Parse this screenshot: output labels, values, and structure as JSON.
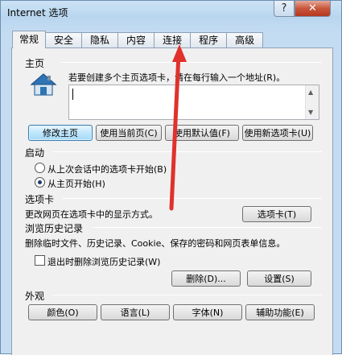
{
  "window": {
    "title": "Internet 选项",
    "help": "?",
    "close": "✕"
  },
  "tabs": [
    "常规",
    "安全",
    "隐私",
    "内容",
    "连接",
    "程序",
    "高级"
  ],
  "home": {
    "section": "主页",
    "description": "若要创建多个主页选项卡，请在每行输入一个地址(R)。",
    "url_value": "",
    "buttons": {
      "current": "修改主页",
      "use_current": "使用当前页(C)",
      "use_default": "使用默认值(F)",
      "new_tab": "使用新选项卡(U)"
    }
  },
  "startup": {
    "section": "启动",
    "option1": "从上次会话中的选项卡开始(B)",
    "option2": "从主页开始(H)",
    "selected": "option2"
  },
  "tabs_section": {
    "section": "选项卡",
    "description": "更改网页在选项卡中的显示方式。",
    "button": "选项卡(T)"
  },
  "history": {
    "section": "浏览历史记录",
    "description": "删除临时文件、历史记录、Cookie、保存的密码和网页表单信息。",
    "checkbox": "退出时删除浏览历史记录(W)",
    "checked": false,
    "delete_button": "删除(D)...",
    "settings_button": "设置(S)"
  },
  "appearance": {
    "section": "外观",
    "colors": "颜色(O)",
    "languages": "语言(L)",
    "fonts": "字体(N)",
    "accessibility": "辅助功能(E)"
  },
  "colors": {
    "accent": "#3c7fb1",
    "annotation_arrow": "#e0312b"
  }
}
